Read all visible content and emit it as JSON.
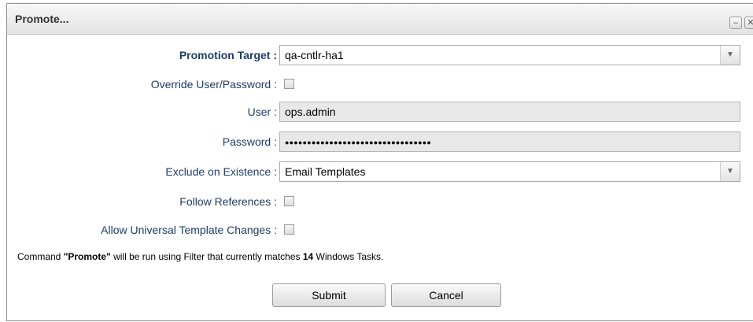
{
  "dialog": {
    "title": "Promote...",
    "minimize_glyph": "–",
    "close_glyph": "✕"
  },
  "form": {
    "promotion_target": {
      "label": "Promotion Target :",
      "value": "qa-cntlr-ha1"
    },
    "override_user_password": {
      "label": "Override User/Password :",
      "checked": false
    },
    "user": {
      "label": "User :",
      "value": "ops.admin"
    },
    "password": {
      "label": "Password :",
      "value": "●●●●●●●●●●●●●●●●●●●●●●●●●●●●●●●●●"
    },
    "exclude_on_existence": {
      "label": "Exclude on Existence :",
      "value": "Email Templates"
    },
    "follow_references": {
      "label": "Follow References :",
      "checked": false
    },
    "allow_universal_template_changes": {
      "label": "Allow Universal Template Changes :",
      "checked": false
    }
  },
  "info": {
    "prefix": "Command ",
    "command": "\"Promote\"",
    "middle": " will be run using Filter that currently matches ",
    "count": "14",
    "suffix": " Windows Tasks."
  },
  "buttons": {
    "submit": "Submit",
    "cancel": "Cancel"
  },
  "icons": {
    "dropdown": "chevron-down-icon"
  }
}
